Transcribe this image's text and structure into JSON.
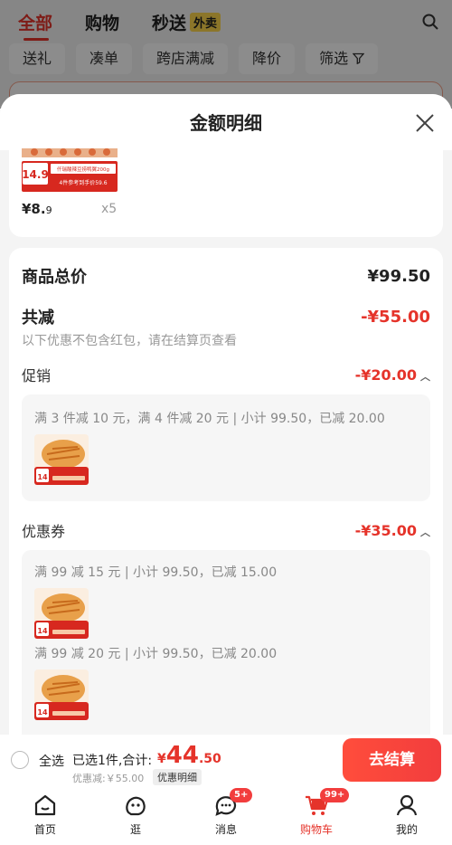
{
  "top_tabs": [
    {
      "label": "全部"
    },
    {
      "label": "购物"
    },
    {
      "label": "秒送",
      "tag": "外卖"
    }
  ],
  "filters": [
    "送礼",
    "凑单",
    "跨店满减",
    "降价",
    "筛选"
  ],
  "sheet": {
    "title": "金额明细",
    "product": {
      "thumb_price": "14.9",
      "thumb_line1": "仟瑞酸辣豆捞鸭翼200g",
      "thumb_line2": "4件参考到手价59.6",
      "price_int": "¥8.",
      "price_dec": "9",
      "qty": "x5"
    },
    "goods_total_label": "商品总价",
    "goods_total_value": "¥99.50",
    "discount_label": "共减",
    "discount_value": "-¥55.00",
    "discount_note": "以下优惠不包含红包，请在结算页查看",
    "promo_label": "促销",
    "promo_value": "-¥20.00",
    "promo_line": "满 3 件减 10 元，满 4 件减 20 元 | 小计 99.50，已减 20.00",
    "coupon_label": "优惠券",
    "coupon_value": "-¥35.00",
    "coupon_line1": "满 99 减 15 元 | 小计 99.50，已减 15.00",
    "coupon_line2": "满 99 减 20 元 | 小计 99.50，已减 20.00",
    "thumb_small_price": "14"
  },
  "checkout": {
    "select_all": "全选",
    "selected": "已选1件,合计:",
    "sym": "¥",
    "total_int": "44",
    "total_dec": ".50",
    "saved": "优惠减:￥55.00",
    "detail_link": "优惠明细",
    "button": "去结算"
  },
  "tabbar": [
    {
      "label": "首页",
      "icon": "home-icon"
    },
    {
      "label": "逛",
      "icon": "explore-icon"
    },
    {
      "label": "消息",
      "icon": "message-icon",
      "badge": "5+"
    },
    {
      "label": "购物车",
      "icon": "cart-icon",
      "badge": "99+",
      "active": true
    },
    {
      "label": "我的",
      "icon": "profile-icon"
    }
  ],
  "colors": {
    "accent": "#e5332a",
    "button": "#f23d3d",
    "waimai": "#ffd84d"
  }
}
